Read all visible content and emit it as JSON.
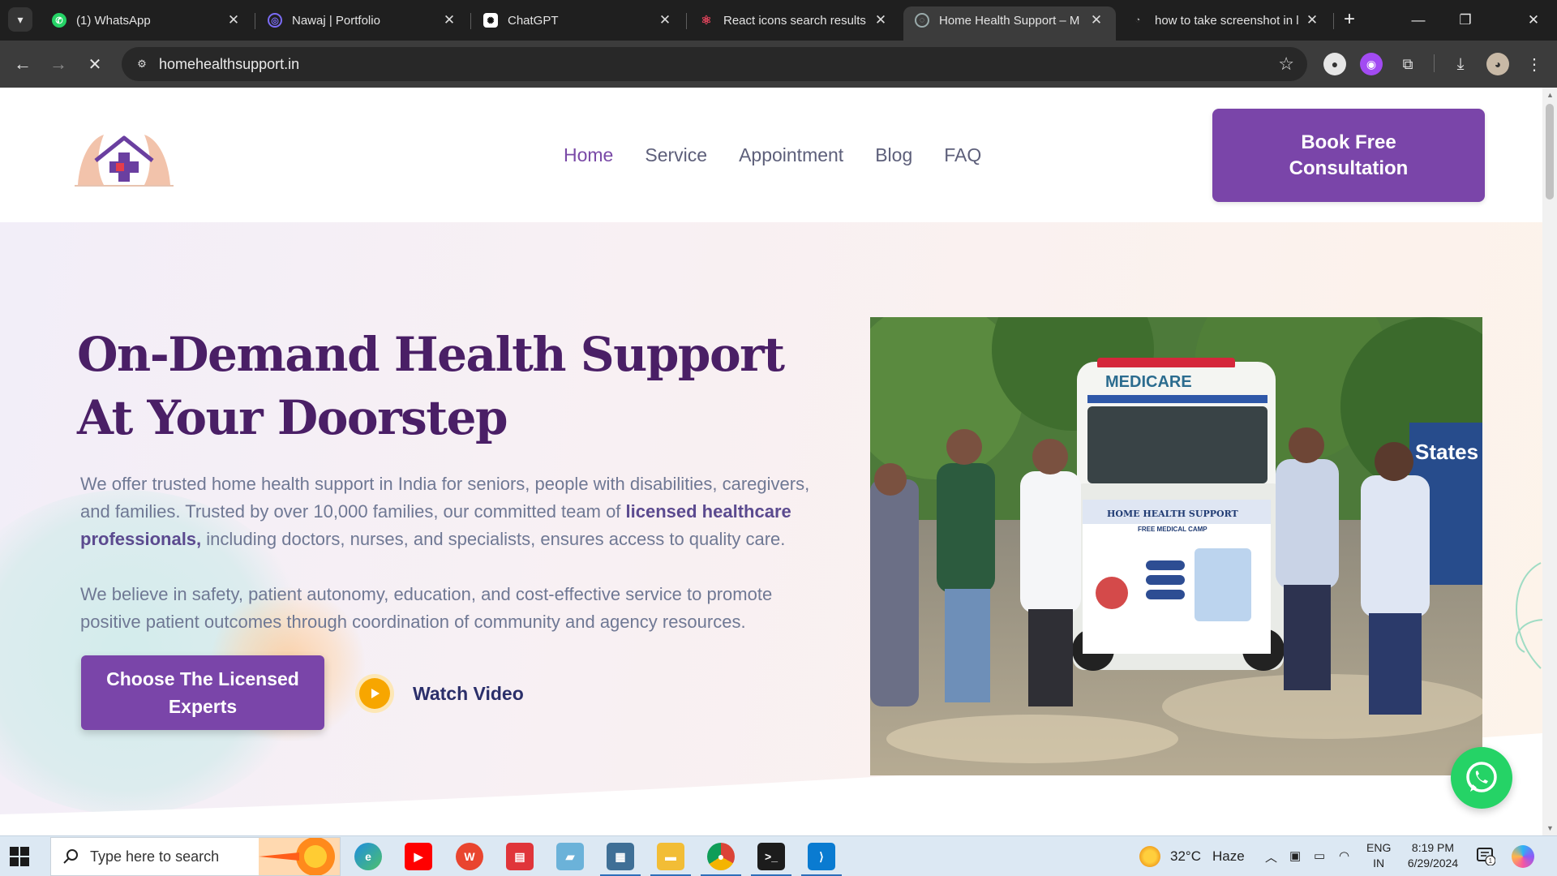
{
  "browser": {
    "tabs": [
      {
        "title": "(1) WhatsApp",
        "favicon": "whatsapp-icon",
        "active": false
      },
      {
        "title": "Nawaj | Portfolio",
        "favicon": "portfolio-icon",
        "active": false
      },
      {
        "title": "ChatGPT",
        "favicon": "chatgpt-icon",
        "active": false
      },
      {
        "title": "React icons search results",
        "favicon": "react-icon",
        "active": false
      },
      {
        "title": "Home Health Support – M",
        "favicon": "globe-icon",
        "active": true
      },
      {
        "title": "how to take screenshot in l",
        "favicon": "loading-icon",
        "active": false
      }
    ],
    "url": "homehealthsupport.in"
  },
  "site": {
    "nav": [
      "Home",
      "Service",
      "Appointment",
      "Blog",
      "FAQ"
    ],
    "active_nav": "Home",
    "header_cta": "Book Free Consultation",
    "colors": {
      "brand_purple": "#7a45a9",
      "heading": "#4a1f66",
      "accent_orange": "#f7a600",
      "whatsapp_green": "#25d366"
    }
  },
  "hero": {
    "title": "On-Demand Health Support At Your Doorstep",
    "p1_a": "We offer trusted home health support in India for seniors, people with disabilities, caregivers, and families. Trusted by over 10,000 families, our committed team of ",
    "p1_bold": "licensed healthcare professionals,",
    "p1_b": " including doctors, nurses, and specialists, ensures access to quality care.",
    "p2": "We believe in safety, patient autonomy, education, and cost-effective service to promote positive patient outcomes through coordination of community and agency resources.",
    "cta": "Choose The Licensed Experts",
    "watch": "Watch Video",
    "photo_texts": {
      "van_label": "MEDICARE",
      "banner_title": "HOME HEALTH SUPPORT",
      "banner_sub": "FREE MEDICAL CAMP",
      "sign_text": "States"
    }
  },
  "taskbar": {
    "search_placeholder": "Type here to search",
    "weather_temp": "32°C",
    "weather_desc": "Haze",
    "lang_top": "ENG",
    "lang_bottom": "IN",
    "time": "8:19 PM",
    "date": "6/29/2024",
    "notification_count": "1"
  }
}
